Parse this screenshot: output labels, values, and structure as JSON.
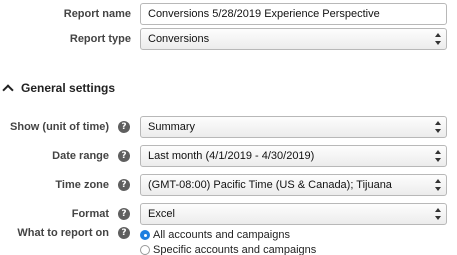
{
  "report": {
    "name_label": "Report name",
    "name_value": "Conversions 5/28/2019 Experience Perspective",
    "type_label": "Report type",
    "type_value": "Conversions"
  },
  "general_settings": {
    "title": "General settings",
    "show": {
      "label": "Show (unit of time)",
      "value": "Summary"
    },
    "date_range": {
      "label": "Date range",
      "value": "Last month (4/1/2019 - 4/30/2019)"
    },
    "time_zone": {
      "label": "Time zone",
      "value": "(GMT-08:00) Pacific Time (US & Canada); Tijuana"
    },
    "format": {
      "label": "Format",
      "value": "Excel"
    },
    "what_to_report": {
      "label": "What to report on",
      "options": [
        {
          "label": "All accounts and campaigns",
          "selected": true
        },
        {
          "label": "Specific accounts and campaigns",
          "selected": false
        }
      ]
    }
  },
  "icons": {
    "help": "?"
  },
  "colors": {
    "radio_selected": "#1e7fe0",
    "help_icon": "#5f5f5f"
  }
}
